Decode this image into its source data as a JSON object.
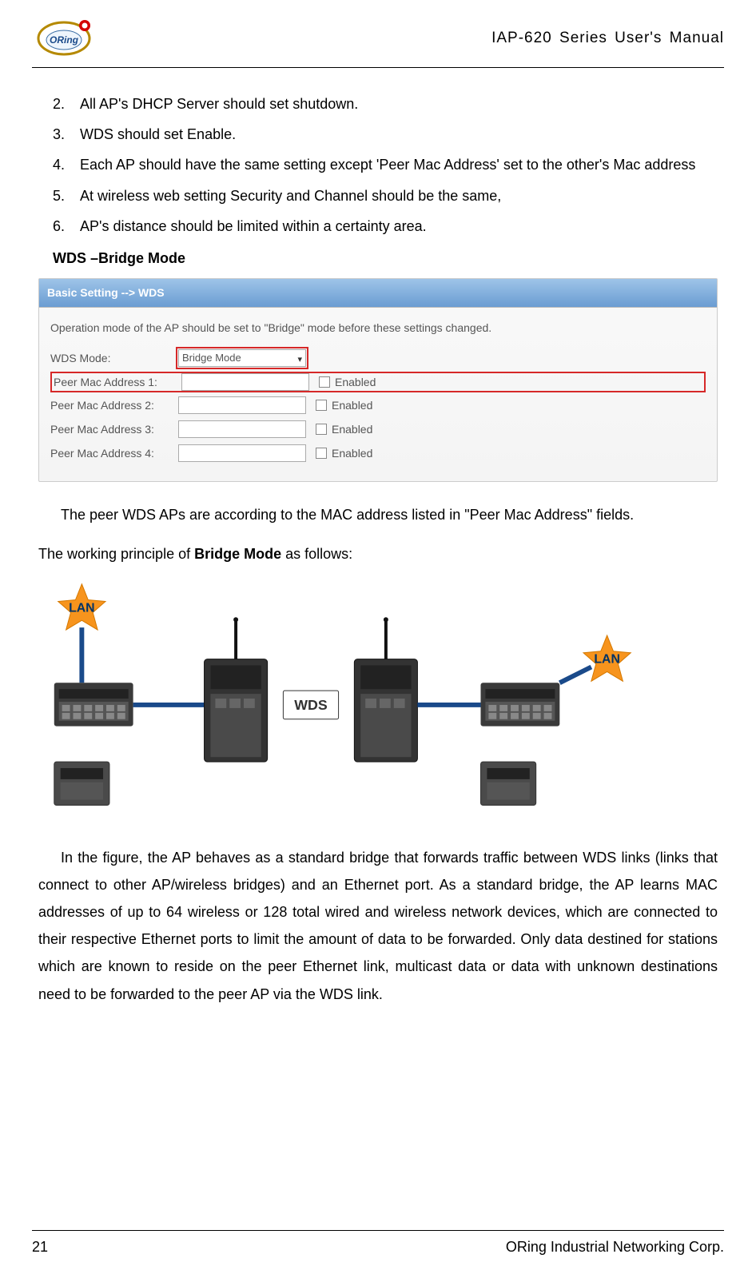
{
  "header": {
    "logo_text": "ORing",
    "manual_title": "IAP-620 Series User's Manual"
  },
  "steps": [
    {
      "num": "2.",
      "text": "All AP's DHCP Server should set shutdown."
    },
    {
      "num": "3.",
      "text": "WDS should set Enable."
    },
    {
      "num": "4.",
      "text": "Each AP should have the same setting except 'Peer Mac Address' set to the other's Mac address"
    },
    {
      "num": "5.",
      "text": "At wireless web setting Security and Channel should be the same,"
    },
    {
      "num": "6.",
      "text": "AP's distance should be limited within a certainty area."
    }
  ],
  "section_subhead": "WDS –Bridge Mode",
  "screenshot": {
    "titlebar": "Basic Setting --> WDS",
    "note": "Operation mode of the AP should be set to \"Bridge\" mode before these settings changed.",
    "rows": [
      {
        "label": "WDS Mode:",
        "field_value": "Bridge Mode",
        "is_select": true,
        "highlight_field": true,
        "highlight_row": false,
        "show_enabled": false
      },
      {
        "label": "Peer Mac Address 1:",
        "field_value": "",
        "is_select": false,
        "highlight_field": false,
        "highlight_row": true,
        "show_enabled": true
      },
      {
        "label": "Peer Mac Address 2:",
        "field_value": "",
        "is_select": false,
        "highlight_field": false,
        "highlight_row": false,
        "show_enabled": true
      },
      {
        "label": "Peer Mac Address 3:",
        "field_value": "",
        "is_select": false,
        "highlight_field": false,
        "highlight_row": false,
        "show_enabled": true
      },
      {
        "label": "Peer Mac Address 4:",
        "field_value": "",
        "is_select": false,
        "highlight_field": false,
        "highlight_row": false,
        "show_enabled": true
      }
    ],
    "enabled_label": "Enabled"
  },
  "para1_a": "The peer WDS APs are according to the MAC address listed in \"Peer Mac Address\" fields.",
  "para1_b_pre": "The working principle of ",
  "para1_b_bold": "Bridge Mode",
  "para1_b_post": " as follows:",
  "diagram": {
    "lan_label": "LAN",
    "wds_label": "WDS"
  },
  "para2": "In the figure, the AP behaves as a standard bridge that forwards traffic between WDS links (links that connect to other AP/wireless bridges) and an Ethernet port.   As a standard bridge, the AP learns MAC addresses of up to 64 wireless or 128 total wired and wireless network devices, which are connected to their respective Ethernet ports to limit the amount of data to be forwarded.   Only data destined for stations which are known to reside on the peer Ethernet link, multicast data or data with unknown destinations need to be forwarded to the peer AP via the WDS link.",
  "footer": {
    "page_number": "21",
    "copyright": "ORing Industrial Networking Corp."
  }
}
